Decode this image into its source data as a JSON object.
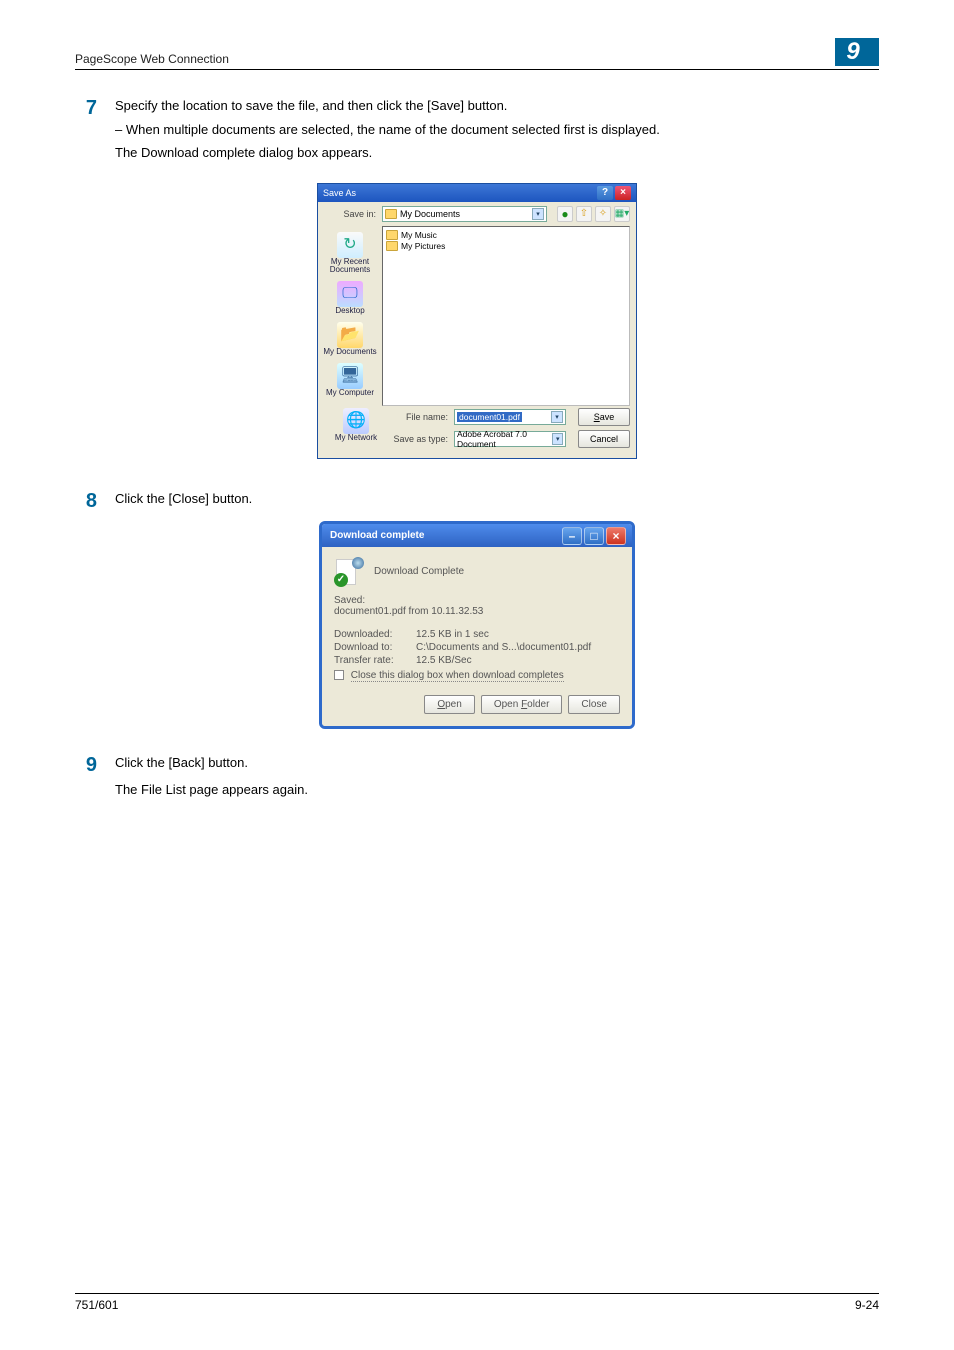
{
  "header": {
    "left": "PageScope Web Connection",
    "badge": "9"
  },
  "steps": {
    "s7": {
      "num": "7",
      "line1": "Specify the location to save the file, and then click the [Save] button.",
      "sub": "–    When multiple documents are selected, the name of the document selected first is displayed.",
      "line2": "The Download complete dialog box appears."
    },
    "s8": {
      "num": "8",
      "line1": "Click the [Close] button."
    },
    "s9": {
      "num": "9",
      "line1": "Click the [Back] button.",
      "line2": "The File List page appears again."
    }
  },
  "saveas": {
    "title": "Save As",
    "savein_label": "Save in:",
    "savein_value": "My Documents",
    "files": [
      "My Music",
      "My Pictures"
    ],
    "places": {
      "recent": "My Recent Documents",
      "desktop": "Desktop",
      "docs": "My Documents",
      "computer": "My Computer",
      "network": "My Network"
    },
    "filename_label": "File name:",
    "filename_value": "document01.pdf",
    "savetype_label": "Save as type:",
    "savetype_value": "Adobe Acrobat 7.0 Document",
    "save_btn": "Save",
    "cancel_btn": "Cancel"
  },
  "download": {
    "title": "Download complete",
    "heading": "Download Complete",
    "saved_label": "Saved:",
    "saved_value": "document01.pdf from 10.11.32.53",
    "rows": {
      "downloaded_label": "Downloaded:",
      "downloaded_value": "12.5 KB in 1 sec",
      "downloadto_label": "Download to:",
      "downloadto_value": "C:\\Documents and S...\\document01.pdf",
      "rate_label": "Transfer rate:",
      "rate_value": "12.5 KB/Sec"
    },
    "checkbox_label": "Close this dialog box when download completes",
    "btn_open": "Open",
    "btn_open_folder": "Open Folder",
    "btn_close": "Close"
  },
  "footer": {
    "left": "751/601",
    "right": "9-24"
  }
}
